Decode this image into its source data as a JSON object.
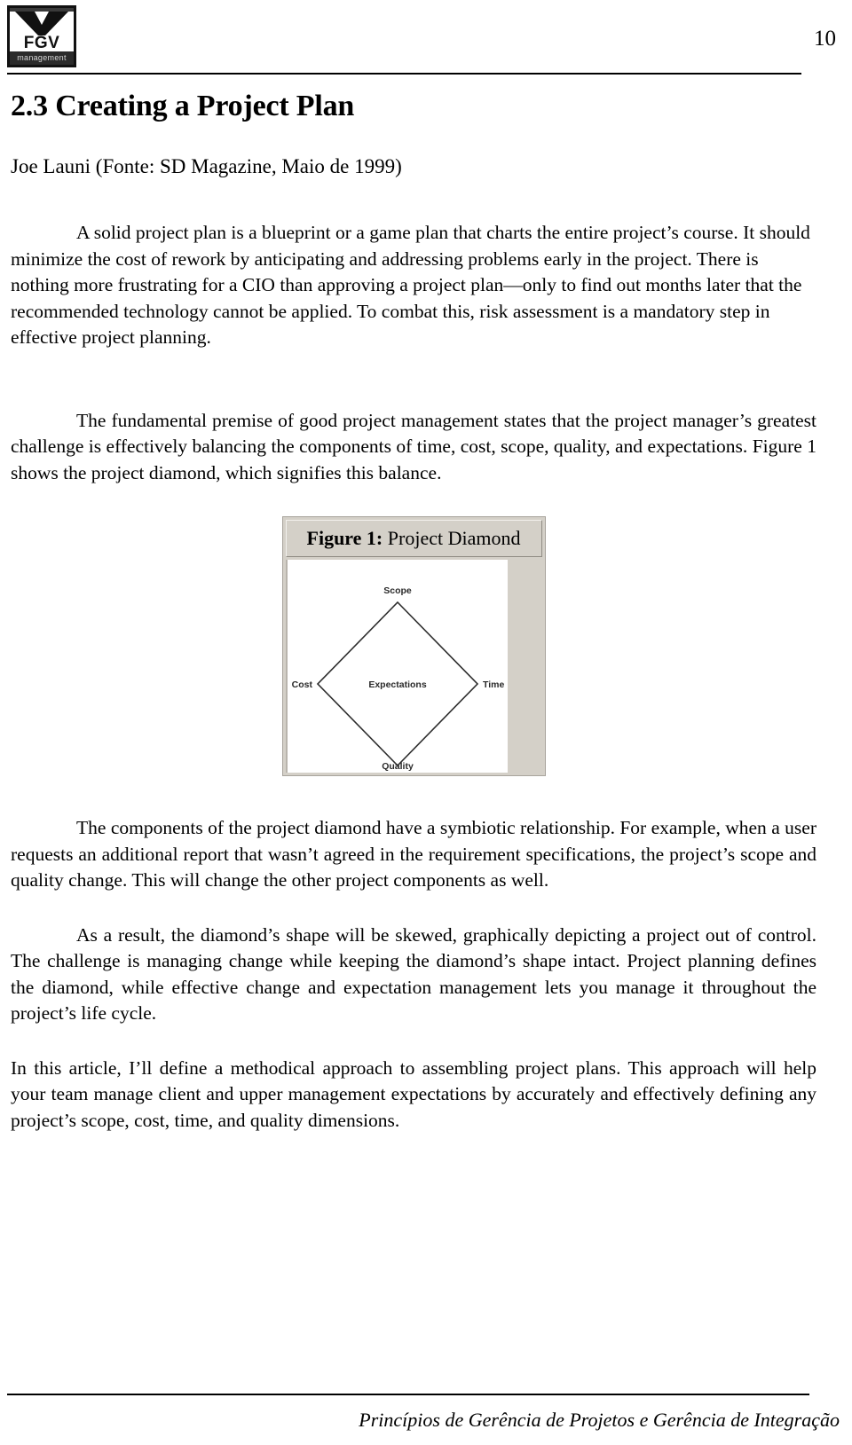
{
  "header": {
    "logo": {
      "name": "FGV",
      "subtitle": "management"
    },
    "page_number": "10"
  },
  "document": {
    "section_number": "2.3",
    "section_title": "2.3 Creating a Project Plan",
    "byline": "Joe Launi (Fonte: SD Magazine, Maio de 1999)",
    "paragraphs": [
      "A solid project plan is a blueprint or a game plan that charts the entire project’s course. It should minimize the cost of rework by anticipating and addressing problems early in the project. There is nothing more frustrating for a CIO than approving a project plan—only to find out months later that the recommended technology cannot be applied. To combat this, risk assessment is a mandatory step in effective project planning.",
      "The fundamental premise of good project management states that the project manager’s greatest challenge is effectively balancing the components of time, cost, scope, quality, and expectations. Figure 1 shows the project diamond, which signifies this balance.",
      "The components of the project diamond have a symbiotic relationship. For example, when a user requests an additional report that wasn’t agreed in the requirement specifications, the project’s scope and quality change. This will change the other project components as well.",
      "As a result, the diamond’s shape will be skewed, graphically depicting a project out of control. The challenge is managing change while keeping the diamond’s shape intact. Project planning defines the diamond, while effective change and expectation management lets you manage it throughout the project’s life cycle.",
      "In this article, I’ll define a methodical approach to assembling project plans. This approach will help your team manage client and upper management expectations by accurately and effectively defining any project’s scope, cost, time, and quality dimensions."
    ]
  },
  "figure": {
    "caption_bold": "Figure 1:",
    "caption_rest": " Project Diamond",
    "diagram": {
      "type": "diamond",
      "top_label": "Scope",
      "left_label": "Cost",
      "right_label": "Time",
      "center_label": "Expectations",
      "bottom_label": "Quality"
    }
  },
  "footer": {
    "text": "Princípios de Gerência de Projetos e Gerência de Integração"
  }
}
